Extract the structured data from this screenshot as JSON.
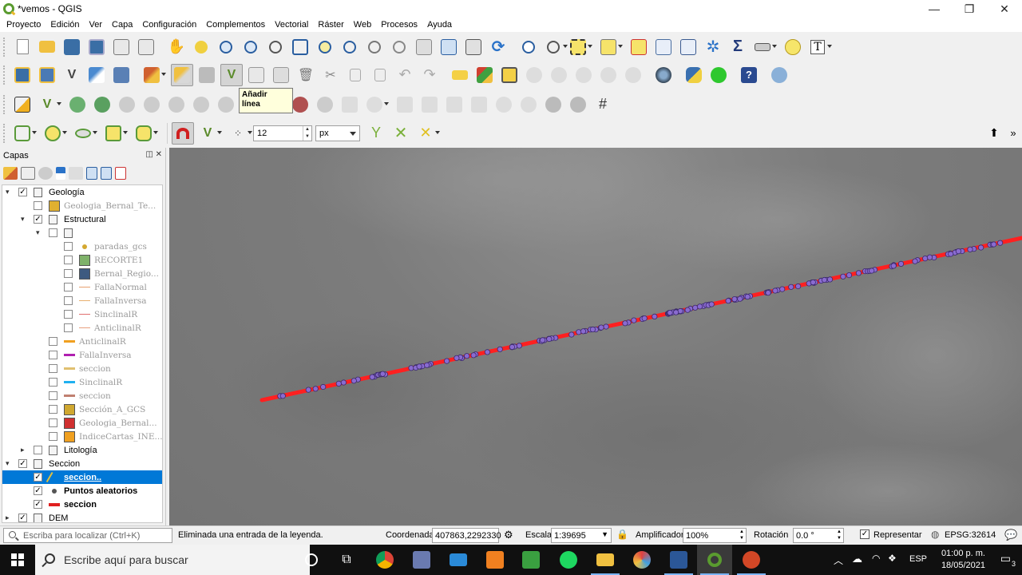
{
  "window": {
    "title": "*vemos - QGIS",
    "buttons": [
      "—",
      "❐",
      "✕"
    ]
  },
  "menu": [
    "Proyecto",
    "Edición",
    "Ver",
    "Capa",
    "Configuración",
    "Complementos",
    "Vectorial",
    "Ráster",
    "Web",
    "Procesos",
    "Ayuda"
  ],
  "tooltip": {
    "line1": "Añadir",
    "line2": "línea"
  },
  "snapping": {
    "tolerance": "12",
    "units": "px"
  },
  "layers_panel": {
    "title": "Capas",
    "header_buttons": "◫ ✕",
    "tree": [
      {
        "label": "Geología",
        "checked": true,
        "expanded": true,
        "type": "group",
        "grey": false
      },
      {
        "label": "Geologia_Bernal_Te...",
        "checked": false,
        "type": "layer",
        "grey": true,
        "color": "#e0b030"
      },
      {
        "label": "Estructural",
        "checked": true,
        "expanded": true,
        "type": "group",
        "grey": false
      },
      {
        "label": "",
        "checked": false,
        "expanded": true,
        "type": "group",
        "grey": false
      },
      {
        "label": "paradas_gcs",
        "checked": false,
        "type": "layer",
        "grey": true,
        "color": "#d4a830"
      },
      {
        "label": "RECORTE1",
        "checked": false,
        "type": "layer",
        "grey": true,
        "color": "#7fb26a"
      },
      {
        "label": "Bernal_Regio...",
        "checked": false,
        "type": "layer",
        "grey": true,
        "color": "#3d5a80"
      },
      {
        "label": "FallaNormal",
        "checked": false,
        "type": "layer",
        "grey": true,
        "color": "#e8a070"
      },
      {
        "label": "FallaInversa",
        "checked": false,
        "type": "layer",
        "grey": true,
        "color": "#e8b070"
      },
      {
        "label": "SinclinalR",
        "checked": false,
        "type": "layer",
        "grey": true,
        "color": "#e07070"
      },
      {
        "label": "AnticlinalR",
        "checked": false,
        "type": "layer",
        "grey": true,
        "color": "#e8a080"
      },
      {
        "label": "AnticlinalR",
        "checked": false,
        "type": "layer",
        "grey": true,
        "color": "#f0a020"
      },
      {
        "label": "FallaInversa",
        "checked": false,
        "type": "layer",
        "grey": true,
        "color": "#b020b0"
      },
      {
        "label": "seccion",
        "checked": false,
        "type": "layer",
        "grey": true,
        "color": "#e0c070"
      },
      {
        "label": "SinclinalR",
        "checked": false,
        "type": "layer",
        "grey": true,
        "color": "#20b0f0"
      },
      {
        "label": "seccion",
        "checked": false,
        "type": "layer",
        "grey": true,
        "color": "#c08070"
      },
      {
        "label": "Sección_A_GCS",
        "checked": false,
        "type": "layer",
        "grey": true,
        "color": "#d0a830"
      },
      {
        "label": "Geologia_Bernal...",
        "checked": false,
        "type": "layer",
        "grey": true,
        "color": "#d03030"
      },
      {
        "label": "IndiceCartas_INE...",
        "checked": false,
        "type": "layer",
        "grey": true,
        "color": "#f0a020"
      },
      {
        "label": "Litología",
        "checked": false,
        "expanded": false,
        "type": "group",
        "grey": false
      },
      {
        "label": "Seccion",
        "checked": true,
        "expanded": true,
        "type": "group",
        "grey": false
      },
      {
        "label": "seccion..",
        "checked": true,
        "type": "layer",
        "grey": false,
        "selected": true,
        "color": "#e0c040"
      },
      {
        "label": "Puntos aleatorios",
        "checked": true,
        "type": "layer",
        "grey": false,
        "bold": true,
        "color": "#555555"
      },
      {
        "label": "seccion",
        "checked": true,
        "type": "layer",
        "grey": false,
        "bold": true,
        "color": "#e02020"
      },
      {
        "label": "DEM",
        "checked": true,
        "expanded": false,
        "type": "group",
        "grey": false
      }
    ]
  },
  "statusbar": {
    "locator_placeholder": "Escriba para localizar (Ctrl+K)",
    "message": "Eliminada una entrada de la leyenda.",
    "coord_label": "Coordenada",
    "coord_value": "407863,2292330",
    "scale_label": "Escala",
    "scale_value": "1:39695",
    "magnifier_label": "Amplificador",
    "magnifier_value": "100%",
    "rotation_label": "Rotación",
    "rotation_value": "0.0 °",
    "render_label": "Representar",
    "crs": "EPSG:32614"
  },
  "taskbar": {
    "search_placeholder": "Escribe aquí para buscar",
    "language": "ESP",
    "time": "01:00 p. m.",
    "date": "18/05/2021",
    "notifications": "3"
  },
  "map": {
    "line_color": "#ff2020",
    "point_color": "#8a6bd0",
    "point_stroke": "#3a2a6a"
  }
}
